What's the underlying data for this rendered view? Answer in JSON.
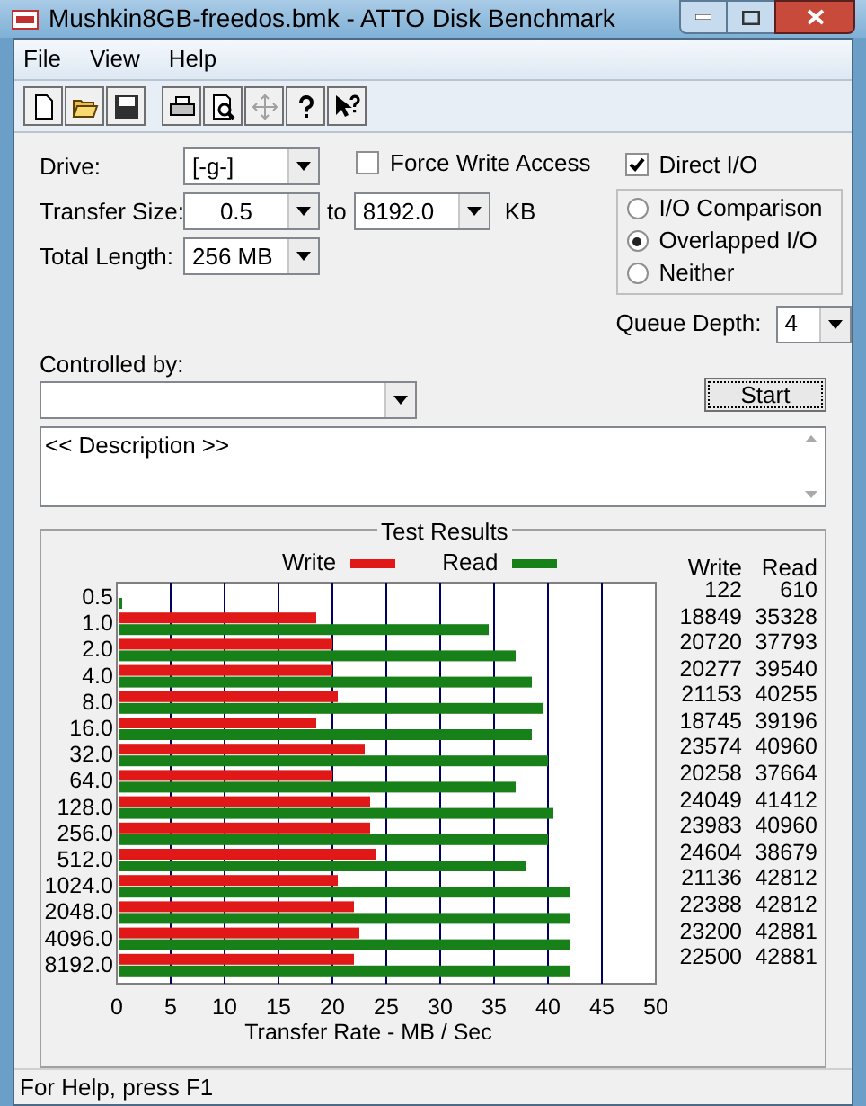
{
  "window": {
    "title": "Mushkin8GB-freedos.bmk - ATTO Disk Benchmark"
  },
  "menu": [
    "File",
    "View",
    "Help"
  ],
  "drive": {
    "label": "Drive:",
    "value": "[-g-]"
  },
  "force_write_access": {
    "label": "Force Write Access",
    "checked": false
  },
  "direct_io": {
    "label": "Direct I/O",
    "checked": true
  },
  "io_mode": [
    {
      "label": "I/O Comparison",
      "selected": false
    },
    {
      "label": "Overlapped I/O",
      "selected": true
    },
    {
      "label": "Neither",
      "selected": false
    }
  ],
  "transfer_size": {
    "label": "Transfer Size:",
    "from": "0.5",
    "to_label": "to",
    "to": "8192.0",
    "unit": "KB"
  },
  "total_length": {
    "label": "Total Length:",
    "value": "256 MB"
  },
  "queue_depth": {
    "label": "Queue Depth:",
    "value": "4"
  },
  "controlled_by": {
    "label": "Controlled by:"
  },
  "start_button": "Start",
  "description": "<< Description >>",
  "test_results": {
    "title": "Test Results",
    "columns": [
      "Write",
      "Read"
    ],
    "rows": [
      {
        "write": "122",
        "read": "610"
      },
      {
        "write": "18849",
        "read": "35328"
      },
      {
        "write": "20720",
        "read": "37793"
      },
      {
        "write": "20277",
        "read": "39540"
      },
      {
        "write": "21153",
        "read": "40255"
      },
      {
        "write": "18745",
        "read": "39196"
      },
      {
        "write": "23574",
        "read": "40960"
      },
      {
        "write": "20258",
        "read": "37664"
      },
      {
        "write": "24049",
        "read": "41412"
      },
      {
        "write": "23983",
        "read": "40960"
      },
      {
        "write": "24604",
        "read": "38679"
      },
      {
        "write": "21136",
        "read": "42812"
      },
      {
        "write": "22388",
        "read": "42812"
      },
      {
        "write": "23200",
        "read": "42881"
      },
      {
        "write": "22500",
        "read": "42881"
      }
    ],
    "chart_data": {
      "type": "bar",
      "orientation": "horizontal",
      "xlabel": "Transfer Rate - MB / Sec",
      "categories": [
        "0.5",
        "1.0",
        "2.0",
        "4.0",
        "8.0",
        "16.0",
        "32.0",
        "64.0",
        "128.0",
        "256.0",
        "512.0",
        "1024.0",
        "2048.0",
        "4096.0",
        "8192.0"
      ],
      "series": [
        {
          "name": "Write",
          "color": "#e01818",
          "values": [
            0,
            18.5,
            20,
            20,
            20.5,
            18.5,
            23,
            20,
            23.5,
            23.5,
            24,
            20.5,
            22,
            22.5,
            22
          ]
        },
        {
          "name": "Read",
          "color": "#188018",
          "values": [
            0.5,
            34.5,
            37,
            38.5,
            39.5,
            38.5,
            40,
            37,
            40.5,
            40,
            38,
            42,
            42,
            42,
            42
          ]
        }
      ],
      "grid": true,
      "xlim": [
        0,
        50
      ],
      "xticks": [
        0,
        5,
        10,
        15,
        20,
        25,
        30,
        35,
        40,
        45,
        50
      ]
    }
  },
  "status_bar": "For Help, press F1"
}
